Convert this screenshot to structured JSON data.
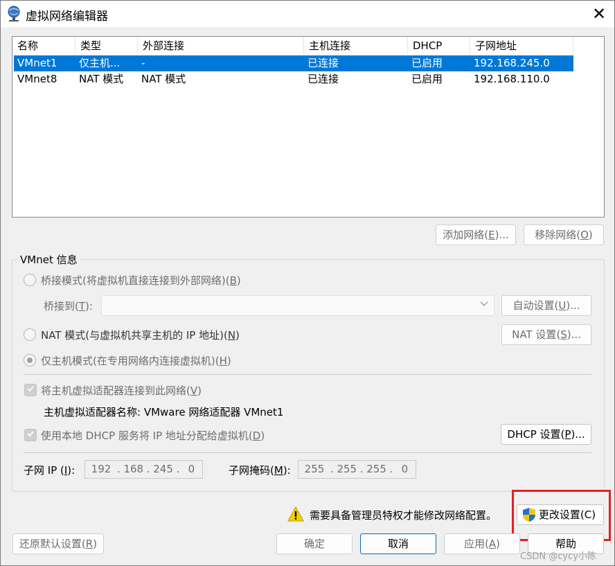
{
  "window": {
    "title": "虚拟网络编辑器",
    "close_glyph": "✕"
  },
  "table": {
    "columns": [
      "名称",
      "类型",
      "外部连接",
      "主机连接",
      "DHCP",
      "子网地址"
    ],
    "rows": [
      {
        "name": "VMnet1",
        "type": "仅主机...",
        "external": "-",
        "host": "已连接",
        "dhcp": "已启用",
        "subnet": "192.168.245.0",
        "selected": true
      },
      {
        "name": "VMnet8",
        "type": "NAT 模式",
        "external": "NAT 模式",
        "host": "已连接",
        "dhcp": "已启用",
        "subnet": "192.168.110.0",
        "selected": false
      }
    ]
  },
  "network_buttons": {
    "add": "添加网络(",
    "add_key": "E",
    "add_tail": ")...",
    "remove": "移除网络(",
    "remove_key": "O",
    "remove_tail": ")"
  },
  "vmnet_info": {
    "title": "VMnet 信息",
    "bridged": {
      "label": "桥接模式(将虚拟机直接连接到外部网络)(",
      "key": "B",
      "tail": ")"
    },
    "bridge_to": {
      "label": "桥接到(",
      "key": "T",
      "tail": "):",
      "value": ""
    },
    "auto_settings": {
      "label": "自动设置(",
      "key": "U",
      "tail": ")..."
    },
    "nat": {
      "label": "NAT 模式(与虚拟机共享主机的 IP 地址)(",
      "key": "N",
      "tail": ")"
    },
    "nat_settings": {
      "label": "NAT 设置(",
      "key": "S",
      "tail": ")..."
    },
    "host_only": {
      "label": "仅主机模式(在专用网络内连接虚拟机)(",
      "key": "H",
      "tail": ")",
      "checked": true
    },
    "connect_adapter": {
      "label": "将主机虚拟适配器连接到此网络(",
      "key": "V",
      "tail": ")",
      "checked": true
    },
    "adapter_name": "主机虚拟适配器名称: VMware 网络适配器 VMnet1",
    "use_dhcp": {
      "label": "使用本地 DHCP 服务将 IP 地址分配给虚拟机(",
      "key": "D",
      "tail": ")",
      "checked": true
    },
    "dhcp_settings": {
      "label": "DHCP 设置(",
      "key": "P",
      "tail": ")..."
    },
    "subnet_ip": {
      "label": "子网 IP (",
      "key": "I",
      "tail": "):",
      "octets": [
        "192",
        "168",
        "245",
        "0"
      ]
    },
    "subnet_mask": {
      "label": "子网掩码(",
      "key": "M",
      "tail": "):",
      "octets": [
        "255",
        "255",
        "255",
        "0"
      ]
    }
  },
  "admin_notice": "需要具备管理员特权才能修改网络配置。",
  "change_settings": {
    "label": "更改设置(C)"
  },
  "footer": {
    "restore": {
      "label": "还原默认设置(",
      "key": "R",
      "tail": ")"
    },
    "ok": "确定",
    "cancel": "取消",
    "apply": {
      "label": "应用(",
      "key": "A",
      "tail": ")"
    },
    "help": "帮助"
  },
  "watermark": "CSDN @cycy小陈",
  "colors": {
    "selection": "#0078d7",
    "highlight_border": "#e42020",
    "shield_blue": "#1e6fd9",
    "shield_yellow": "#f7c600"
  }
}
